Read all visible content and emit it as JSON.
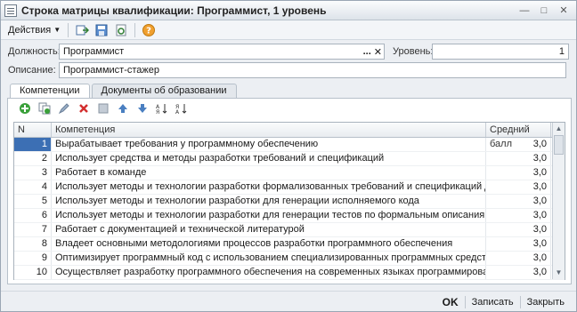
{
  "window": {
    "title": "Строка матрицы квалификации: Программист, 1 уровень"
  },
  "toolbar": {
    "actions_label": "Действия"
  },
  "form": {
    "position_label": "Должность:",
    "position_value": "Программист",
    "level_label": "Уровень:",
    "level_value": "1",
    "description_label": "Описание:",
    "description_value": "Программист-стажер"
  },
  "tabs": [
    {
      "label": "Компетенции",
      "active": true
    },
    {
      "label": "Документы об образовании",
      "active": false
    }
  ],
  "grid": {
    "columns": [
      "N",
      "Компетенция",
      "Средний балл"
    ],
    "rows": [
      {
        "n": "1",
        "competence": "Вырабатывает требования у программному обеспечению",
        "score": "3,0"
      },
      {
        "n": "2",
        "competence": "Использует средства и методы разработки требований и спецификаций",
        "score": "3,0"
      },
      {
        "n": "3",
        "competence": "Работает в команде",
        "score": "3,0"
      },
      {
        "n": "4",
        "competence": "Использует методы и технологии разработки формализованных требований и спецификаций для контроля ...",
        "score": "3,0"
      },
      {
        "n": "5",
        "competence": "Использует методы и технологии разработки для генерации исполняемого кода",
        "score": "3,0"
      },
      {
        "n": "6",
        "competence": "Использует методы и технологии разработки для генерации тестов по формальным описаниям",
        "score": "3,0"
      },
      {
        "n": "7",
        "competence": "Работает с документацией и технической литературой",
        "score": "3,0"
      },
      {
        "n": "8",
        "competence": "Владеет основными методологиями процессов разработки программного обеспечения",
        "score": "3,0"
      },
      {
        "n": "9",
        "competence": "Оптимизирует программный код с использованием специализированных программных средств",
        "score": "3,0"
      },
      {
        "n": "10",
        "competence": "Осуществляет разработку программного обеспечения на современных языках программирования",
        "score": "3,0"
      }
    ]
  },
  "buttons": {
    "ok": "OK",
    "save": "Записать",
    "close": "Закрыть"
  }
}
